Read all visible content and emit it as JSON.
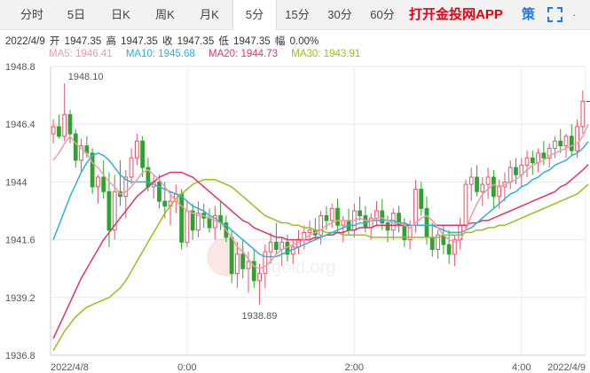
{
  "tabs": [
    {
      "label": "分时",
      "active": false
    },
    {
      "label": "5日",
      "active": false
    },
    {
      "label": "日K",
      "active": false
    },
    {
      "label": "周K",
      "active": false
    },
    {
      "label": "月K",
      "active": false
    },
    {
      "label": "5分",
      "active": true
    },
    {
      "label": "15分",
      "active": false
    },
    {
      "label": "30分",
      "active": false
    },
    {
      "label": "60分",
      "active": false
    }
  ],
  "brand": "打开金投网APP",
  "toolbar": {
    "ce_label": "策",
    "more_label": "·",
    "fullscreen_icon": "fullscreen-icon"
  },
  "ohlc": {
    "date": "2022/4/9",
    "open_label": "开",
    "open": "1947.35",
    "high_label": "高",
    "high": "1947.35",
    "close_label": "收",
    "close": "1947.35",
    "low_label": "低",
    "low": "1947.35",
    "range_label": "幅",
    "range": "0.00%"
  },
  "ma_legend": [
    {
      "label": "MA5: 1946.41",
      "color": "#f09aaa"
    },
    {
      "label": "MA10: 1945.68",
      "color": "#2bb3d6"
    },
    {
      "label": "MA20: 1944.73",
      "color": "#e0356b"
    },
    {
      "label": "MA30: 1943.91",
      "color": "#9ebc1e"
    }
  ],
  "watermark": "cngold.org",
  "chart_data": {
    "type": "candlestick",
    "y_ticks": [
      "1948.8",
      "1946.4",
      "1944",
      "1941.6",
      "1939.2",
      "1936.8"
    ],
    "ylim": [
      1936.8,
      1948.8
    ],
    "x_ticks": [
      "2022/4/8",
      "0:00",
      "2:00",
      "4:00",
      "2022/4/9"
    ],
    "x_tick_index": [
      0,
      24,
      54,
      84,
      97
    ],
    "high_annotation": "1948.10",
    "low_annotation": "1938.89",
    "colors": {
      "up": "#e0566c",
      "down": "#2fa32f",
      "ma5": "#f09aaa",
      "ma10": "#2bb3d6",
      "ma20": "#e0356b",
      "ma30": "#9ebc1e"
    },
    "candles": [
      [
        1946.0,
        1946.6,
        1945.6,
        1946.3
      ],
      [
        1946.3,
        1946.8,
        1945.8,
        1945.9
      ],
      [
        1945.9,
        1948.1,
        1945.7,
        1946.8
      ],
      [
        1946.8,
        1947.0,
        1945.6,
        1946.0
      ],
      [
        1946.0,
        1946.2,
        1944.6,
        1944.9
      ],
      [
        1944.9,
        1945.8,
        1944.4,
        1945.5
      ],
      [
        1945.5,
        1945.9,
        1945.0,
        1945.2
      ],
      [
        1945.2,
        1945.4,
        1943.5,
        1943.8
      ],
      [
        1943.8,
        1944.3,
        1943.1,
        1944.2
      ],
      [
        1944.2,
        1944.9,
        1943.3,
        1943.6
      ],
      [
        1943.6,
        1944.4,
        1941.3,
        1942.0
      ],
      [
        1942.0,
        1944.3,
        1941.6,
        1943.6
      ],
      [
        1943.6,
        1944.9,
        1943.0,
        1943.4
      ],
      [
        1943.4,
        1944.5,
        1942.5,
        1944.2
      ],
      [
        1944.2,
        1945.4,
        1943.9,
        1945.0
      ],
      [
        1945.0,
        1946.0,
        1944.7,
        1945.7
      ],
      [
        1945.7,
        1945.9,
        1944.2,
        1944.6
      ],
      [
        1944.6,
        1945.0,
        1943.6,
        1943.8
      ],
      [
        1943.8,
        1944.3,
        1943.3,
        1944.0
      ],
      [
        1944.0,
        1944.3,
        1942.9,
        1943.2
      ],
      [
        1943.2,
        1944.0,
        1942.5,
        1943.0
      ],
      [
        1943.0,
        1943.6,
        1942.2,
        1943.2
      ],
      [
        1943.2,
        1943.9,
        1942.7,
        1943.5
      ],
      [
        1943.5,
        1943.7,
        1941.2,
        1941.5
      ],
      [
        1941.5,
        1943.2,
        1941.3,
        1942.8
      ],
      [
        1942.8,
        1943.1,
        1941.6,
        1942.0
      ],
      [
        1942.0,
        1943.2,
        1941.7,
        1942.7
      ],
      [
        1942.7,
        1943.1,
        1942.1,
        1942.5
      ],
      [
        1942.5,
        1942.9,
        1941.9,
        1942.1
      ],
      [
        1942.1,
        1943.0,
        1941.6,
        1942.6
      ],
      [
        1942.6,
        1943.2,
        1942.0,
        1942.3
      ],
      [
        1942.3,
        1942.6,
        1941.5,
        1941.7
      ],
      [
        1941.7,
        1942.0,
        1939.8,
        1940.2
      ],
      [
        1940.2,
        1941.5,
        1939.6,
        1941.0
      ],
      [
        1941.0,
        1941.6,
        1940.0,
        1940.4
      ],
      [
        1940.4,
        1941.1,
        1939.4,
        1940.7
      ],
      [
        1940.7,
        1941.2,
        1939.6,
        1939.9
      ],
      [
        1939.9,
        1940.6,
        1938.9,
        1940.2
      ],
      [
        1940.2,
        1941.4,
        1939.6,
        1941.1
      ],
      [
        1941.1,
        1941.9,
        1940.6,
        1941.5
      ],
      [
        1941.5,
        1942.3,
        1941.0,
        1941.2
      ],
      [
        1941.2,
        1941.7,
        1940.5,
        1941.5
      ],
      [
        1941.5,
        1941.8,
        1940.7,
        1941.0
      ],
      [
        1941.0,
        1941.6,
        1940.6,
        1941.3
      ],
      [
        1941.3,
        1942.0,
        1941.0,
        1941.6
      ],
      [
        1941.6,
        1942.2,
        1941.2,
        1941.9
      ],
      [
        1941.9,
        1942.4,
        1941.5,
        1942.0
      ],
      [
        1942.0,
        1942.5,
        1941.6,
        1941.8
      ],
      [
        1941.8,
        1942.8,
        1941.4,
        1942.6
      ],
      [
        1942.6,
        1943.0,
        1942.0,
        1942.4
      ],
      [
        1942.4,
        1943.1,
        1942.1,
        1942.9
      ],
      [
        1942.9,
        1943.3,
        1941.9,
        1942.2
      ],
      [
        1942.2,
        1942.6,
        1941.5,
        1942.4
      ],
      [
        1942.4,
        1942.9,
        1941.8,
        1942.0
      ],
      [
        1942.0,
        1943.1,
        1941.7,
        1942.8
      ],
      [
        1942.8,
        1943.4,
        1942.4,
        1942.6
      ],
      [
        1942.6,
        1943.0,
        1941.9,
        1942.1
      ],
      [
        1942.1,
        1942.7,
        1941.6,
        1942.5
      ],
      [
        1942.5,
        1943.2,
        1942.2,
        1942.8
      ],
      [
        1942.8,
        1943.3,
        1942.0,
        1942.3
      ],
      [
        1942.3,
        1942.6,
        1941.5,
        1942.0
      ],
      [
        1942.0,
        1942.9,
        1941.6,
        1942.7
      ],
      [
        1942.7,
        1943.0,
        1941.9,
        1942.2
      ],
      [
        1942.2,
        1942.5,
        1941.3,
        1941.6
      ],
      [
        1941.6,
        1942.4,
        1941.2,
        1942.2
      ],
      [
        1942.2,
        1944.1,
        1941.9,
        1943.7
      ],
      [
        1943.7,
        1944.0,
        1942.6,
        1942.9
      ],
      [
        1942.9,
        1943.4,
        1941.4,
        1941.7
      ],
      [
        1941.7,
        1942.3,
        1940.9,
        1941.2
      ],
      [
        1941.2,
        1942.0,
        1940.8,
        1941.8
      ],
      [
        1941.8,
        1942.2,
        1941.0,
        1941.4
      ],
      [
        1941.4,
        1942.0,
        1940.6,
        1941.0
      ],
      [
        1941.0,
        1941.8,
        1940.5,
        1941.6
      ],
      [
        1941.6,
        1942.5,
        1941.2,
        1942.2
      ],
      [
        1942.2,
        1944.1,
        1942.0,
        1943.9
      ],
      [
        1943.9,
        1944.6,
        1943.2,
        1944.2
      ],
      [
        1944.2,
        1944.7,
        1943.4,
        1943.6
      ],
      [
        1943.6,
        1944.2,
        1943.0,
        1943.9
      ],
      [
        1943.9,
        1944.6,
        1943.3,
        1944.2
      ],
      [
        1944.2,
        1944.5,
        1942.9,
        1943.4
      ],
      [
        1943.4,
        1944.1,
        1942.9,
        1943.8
      ],
      [
        1943.8,
        1944.4,
        1943.2,
        1944.0
      ],
      [
        1944.0,
        1944.9,
        1943.7,
        1944.6
      ],
      [
        1944.6,
        1945.0,
        1943.9,
        1944.3
      ],
      [
        1944.3,
        1945.0,
        1943.8,
        1944.7
      ],
      [
        1944.7,
        1945.3,
        1944.2,
        1945.0
      ],
      [
        1945.0,
        1945.3,
        1944.3,
        1944.8
      ],
      [
        1944.8,
        1945.4,
        1944.4,
        1945.2
      ],
      [
        1945.2,
        1945.7,
        1944.7,
        1945.0
      ],
      [
        1945.0,
        1945.6,
        1944.6,
        1945.4
      ],
      [
        1945.4,
        1945.9,
        1945.0,
        1945.7
      ],
      [
        1945.7,
        1946.2,
        1945.2,
        1945.5
      ],
      [
        1945.5,
        1946.0,
        1945.0,
        1945.9
      ],
      [
        1945.9,
        1946.4,
        1945.1,
        1945.3
      ],
      [
        1945.3,
        1946.6,
        1945.0,
        1946.3
      ],
      [
        1946.3,
        1947.8,
        1946.0,
        1947.35
      ]
    ],
    "ma5": [
      1944.9,
      1945.2,
      1945.6,
      1945.9,
      1945.6,
      1945.4,
      1945.2,
      1944.8,
      1944.6,
      1944.3,
      1944.0,
      1943.8,
      1943.5,
      1943.6,
      1943.8,
      1944.1,
      1944.4,
      1944.5,
      1944.3,
      1944.1,
      1943.8,
      1943.5,
      1943.2,
      1943.0,
      1942.8,
      1942.7,
      1942.6,
      1942.6,
      1942.5,
      1942.4,
      1942.3,
      1942.0,
      1941.7,
      1941.3,
      1941.1,
      1940.8,
      1940.5,
      1940.4,
      1940.5,
      1940.7,
      1941.0,
      1941.2,
      1941.3,
      1941.4,
      1941.5,
      1941.6,
      1941.8,
      1941.9,
      1942.0,
      1942.2,
      1942.3,
      1942.4,
      1942.4,
      1942.4,
      1942.4,
      1942.5,
      1942.4,
      1942.4,
      1942.5,
      1942.5,
      1942.4,
      1942.3,
      1942.3,
      1942.2,
      1942.1,
      1942.3,
      1942.5,
      1942.6,
      1942.4,
      1942.1,
      1941.8,
      1941.6,
      1941.5,
      1941.6,
      1942.0,
      1942.6,
      1943.1,
      1943.5,
      1943.7,
      1943.9,
      1943.8,
      1943.9,
      1944.0,
      1944.1,
      1944.3,
      1944.5,
      1944.7,
      1944.8,
      1944.9,
      1945.1,
      1945.2,
      1945.3,
      1945.4,
      1945.5,
      1945.6,
      1945.9,
      1946.41
    ],
    "ma10": [
      1941.6,
      1942.2,
      1942.8,
      1943.4,
      1943.9,
      1944.4,
      1944.8,
      1945.1,
      1945.2,
      1945.1,
      1944.9,
      1944.6,
      1944.3,
      1944.1,
      1944.0,
      1944.0,
      1944.0,
      1944.0,
      1943.9,
      1943.8,
      1943.7,
      1943.6,
      1943.5,
      1943.4,
      1943.2,
      1943.0,
      1942.9,
      1942.8,
      1942.6,
      1942.5,
      1942.3,
      1942.2,
      1942.0,
      1941.8,
      1941.6,
      1941.4,
      1941.2,
      1941.0,
      1940.9,
      1940.9,
      1940.9,
      1941.0,
      1941.1,
      1941.2,
      1941.3,
      1941.4,
      1941.5,
      1941.6,
      1941.7,
      1941.8,
      1941.9,
      1942.0,
      1942.1,
      1942.2,
      1942.2,
      1942.3,
      1942.3,
      1942.4,
      1942.4,
      1942.4,
      1942.4,
      1942.4,
      1942.3,
      1942.3,
      1942.2,
      1942.2,
      1942.2,
      1942.2,
      1942.2,
      1942.1,
      1942.0,
      1941.9,
      1941.9,
      1941.9,
      1942.0,
      1942.1,
      1942.3,
      1942.5,
      1942.7,
      1942.9,
      1943.1,
      1943.3,
      1943.5,
      1943.6,
      1943.8,
      1943.9,
      1944.1,
      1944.2,
      1944.4,
      1944.5,
      1944.7,
      1944.8,
      1944.9,
      1945.1,
      1945.2,
      1945.4,
      1945.68
    ],
    "ma20": [
      1937.5,
      1938.0,
      1938.5,
      1939.0,
      1939.5,
      1940.0,
      1940.4,
      1940.8,
      1941.2,
      1941.6,
      1941.9,
      1942.2,
      1942.5,
      1942.8,
      1943.1,
      1943.4,
      1943.6,
      1943.8,
      1944.0,
      1944.2,
      1944.3,
      1944.4,
      1944.4,
      1944.4,
      1944.3,
      1944.2,
      1944.0,
      1943.8,
      1943.6,
      1943.4,
      1943.2,
      1943.0,
      1942.8,
      1942.6,
      1942.4,
      1942.3,
      1942.1,
      1942.0,
      1941.9,
      1941.8,
      1941.7,
      1941.7,
      1941.6,
      1941.6,
      1941.6,
      1941.6,
      1941.6,
      1941.7,
      1941.7,
      1941.8,
      1941.8,
      1941.9,
      1941.9,
      1942.0,
      1942.0,
      1942.1,
      1942.1,
      1942.1,
      1942.2,
      1942.2,
      1942.2,
      1942.2,
      1942.2,
      1942.2,
      1942.2,
      1942.2,
      1942.2,
      1942.2,
      1942.2,
      1942.2,
      1942.2,
      1942.2,
      1942.2,
      1942.2,
      1942.2,
      1942.3,
      1942.3,
      1942.4,
      1942.4,
      1942.5,
      1942.6,
      1942.7,
      1942.8,
      1942.9,
      1943.0,
      1943.1,
      1943.2,
      1943.3,
      1943.4,
      1943.5,
      1943.6,
      1943.8,
      1943.9,
      1944.1,
      1944.3,
      1944.5,
      1944.73
    ],
    "ma30": [
      1937.0,
      1937.4,
      1937.8,
      1938.1,
      1938.4,
      1938.6,
      1938.8,
      1938.9,
      1939.0,
      1939.1,
      1939.2,
      1939.4,
      1939.6,
      1939.9,
      1940.3,
      1940.7,
      1941.1,
      1941.5,
      1941.9,
      1942.3,
      1942.7,
      1943.0,
      1943.3,
      1943.5,
      1943.7,
      1943.9,
      1944.0,
      1944.1,
      1944.1,
      1944.1,
      1944.0,
      1943.9,
      1943.8,
      1943.6,
      1943.4,
      1943.2,
      1943.0,
      1942.8,
      1942.6,
      1942.5,
      1942.4,
      1942.3,
      1942.3,
      1942.2,
      1942.2,
      1942.1,
      1942.1,
      1942.0,
      1942.0,
      1941.9,
      1941.9,
      1941.9,
      1941.8,
      1941.8,
      1941.8,
      1941.8,
      1941.8,
      1941.7,
      1941.7,
      1941.7,
      1941.7,
      1941.7,
      1941.7,
      1941.7,
      1941.7,
      1941.7,
      1941.7,
      1941.7,
      1941.7,
      1941.7,
      1941.8,
      1941.8,
      1941.8,
      1941.8,
      1941.9,
      1941.9,
      1942.0,
      1942.0,
      1942.1,
      1942.1,
      1942.2,
      1942.2,
      1942.3,
      1942.4,
      1942.5,
      1942.6,
      1942.7,
      1942.8,
      1942.9,
      1943.0,
      1943.1,
      1943.2,
      1943.3,
      1943.4,
      1943.5,
      1943.7,
      1943.91
    ]
  }
}
